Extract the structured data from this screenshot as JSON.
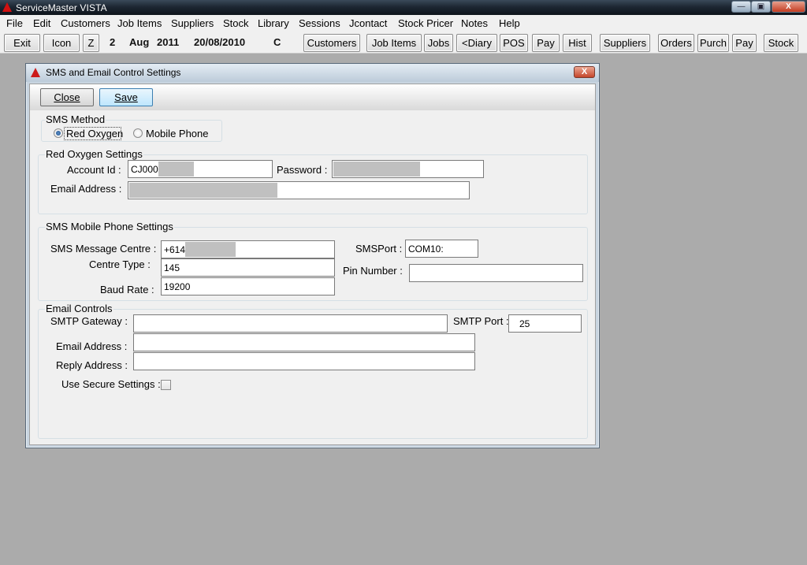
{
  "app": {
    "title": "ServiceMaster VISTA",
    "window_buttons": {
      "minimize": "—",
      "maximize": "▣",
      "close": "X"
    }
  },
  "menu": [
    "File",
    "Edit",
    "Customers",
    "Job Items",
    "Suppliers",
    "Stock",
    "Library",
    "Sessions",
    "Jcontact",
    "Stock Pricer",
    "Notes",
    "Help"
  ],
  "toolbar": {
    "exit": "Exit",
    "icon": "Icon",
    "z": "Z",
    "day_num": "2",
    "month": "Aug",
    "year": "2011",
    "date": "20/08/2010",
    "code": "C",
    "customers": "Customers",
    "job_items": "Job Items",
    "jobs": "Jobs",
    "diary": "<Diary",
    "pos": "POS",
    "pay": "Pay",
    "hist": "Hist",
    "suppliers": "Suppliers",
    "orders": "Orders",
    "purch": "Purch",
    "pay2": "Pay",
    "stock": "Stock"
  },
  "dialog": {
    "title": "SMS and Email Control Settings",
    "close_x": "X",
    "close_button": "Close",
    "save_button": "Save",
    "sms_method": {
      "label": "SMS Method",
      "options": [
        "Red Oxygen",
        "Mobile Phone"
      ],
      "selected": "Red Oxygen"
    },
    "red_oxygen": {
      "label": "Red Oxygen Settings",
      "account_id_label": "Account Id :",
      "account_id_value": "CJ000",
      "password_label": "Password :",
      "email_label": "Email Address :"
    },
    "sms_mobile": {
      "label": "SMS Mobile Phone Settings",
      "message_centre_label": "SMS Message Centre :",
      "message_centre_value": "+614",
      "centre_type_label": "Centre Type :",
      "centre_type_value": "145",
      "baud_rate_label": "Baud Rate :",
      "baud_rate_value": "19200",
      "sms_port_label": "SMSPort :",
      "sms_port_value": "COM10:",
      "pin_label": "Pin Number :",
      "pin_value": ""
    },
    "email_controls": {
      "label": "Email Controls",
      "smtp_gateway_label": "SMTP Gateway :",
      "smtp_gateway_value": "",
      "smtp_port_label": "SMTP Port :",
      "smtp_port_value": "25",
      "email_label": "Email Address :",
      "email_value": "",
      "reply_label": "Reply Address :",
      "reply_value": "",
      "secure_label": "Use Secure Settings :",
      "secure_checked": false
    }
  }
}
